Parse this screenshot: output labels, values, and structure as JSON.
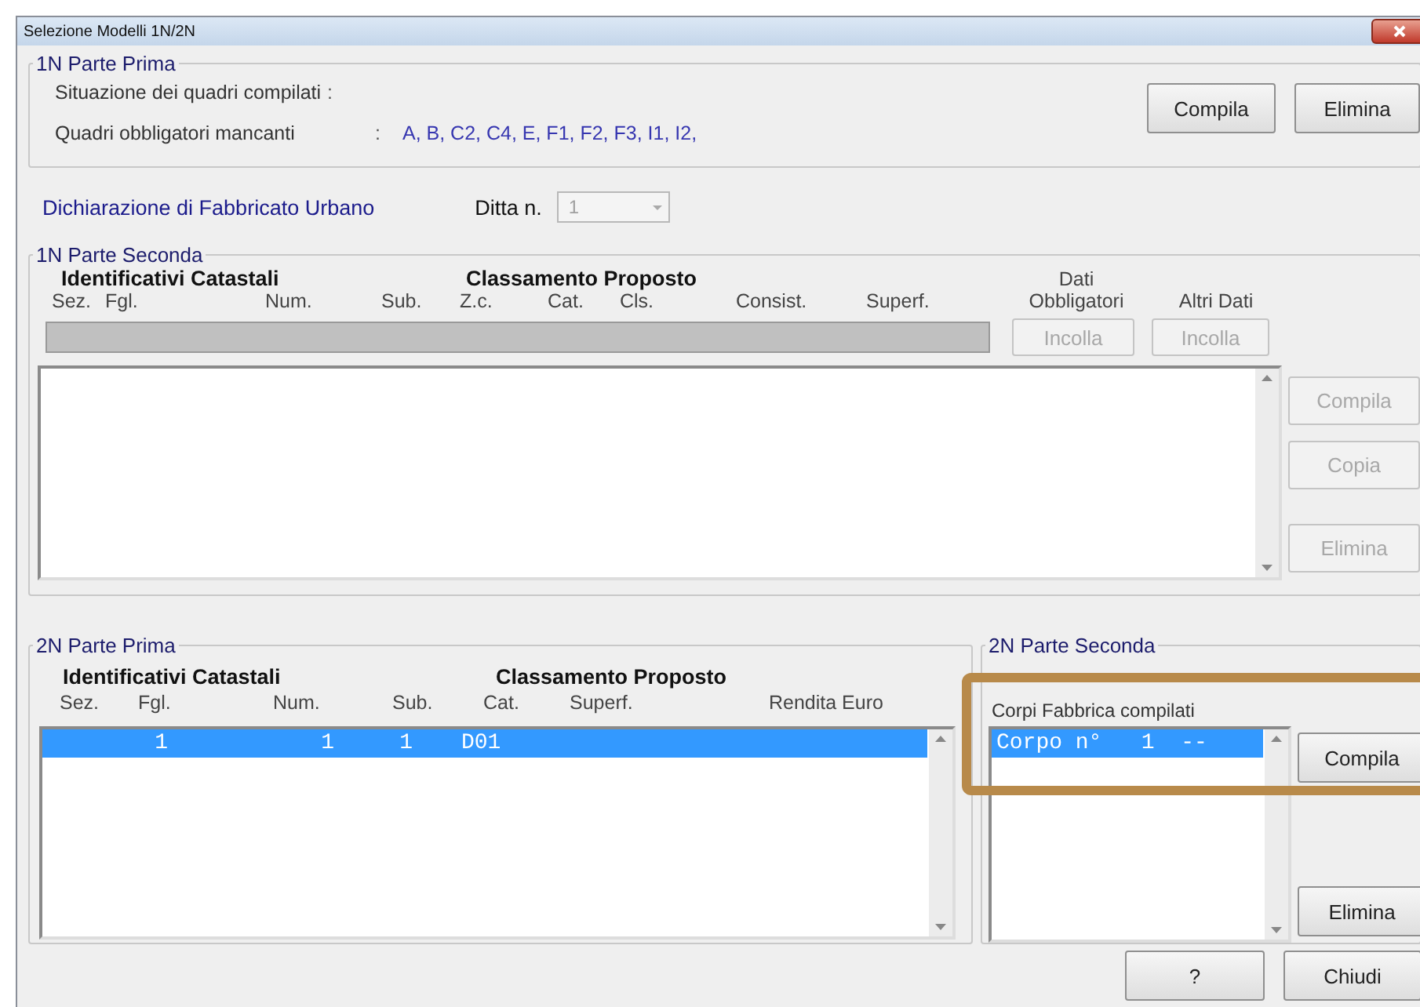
{
  "window": {
    "title": "Selezione Modelli 1N/2N"
  },
  "parte_prima_1n": {
    "legend": "1N Parte Prima",
    "rows": [
      {
        "label": "Situazione dei quadri compilati",
        "separator": ":"
      },
      {
        "label": "Quadri obbligatori mancanti",
        "separator": ":",
        "value": "A, B, C2, C4, E, F1, F2, F3, I1, I2,"
      }
    ],
    "buttons": [
      {
        "label": "Compila",
        "disabled": false
      },
      {
        "label": "Elimina",
        "disabled": false
      }
    ]
  },
  "dichiarazione": {
    "title": "Dichiarazione di Fabbricato Urbano",
    "ditta_label": "Ditta n.",
    "ditta_value": "1",
    "ditta_disabled": true
  },
  "parte_seconda_1n": {
    "legend": "1N Parte Seconda",
    "group_headers": [
      "Identificativi Catastali",
      "Classamento Proposto"
    ],
    "columns": [
      "Sez.",
      "Fgl.",
      "Num.",
      "Sub.",
      "Z.c.",
      "Cat.",
      "Cls.",
      "Consist.",
      "Superf."
    ],
    "data_headers": [
      {
        "lines": [
          "Dati",
          "Obbligatori"
        ]
      },
      {
        "lines": [
          "Altri Dati"
        ]
      }
    ],
    "paste_buttons": [
      {
        "label": "Incolla",
        "disabled": true
      },
      {
        "label": "Incolla",
        "disabled": true
      }
    ],
    "side_buttons": [
      {
        "label": "Compila",
        "disabled": true
      },
      {
        "label": "Copia",
        "disabled": true
      },
      {
        "label": "Elimina",
        "disabled": true
      }
    ]
  },
  "parte_prima_2n": {
    "legend": "2N Parte Prima",
    "group_headers": [
      "Identificativi Catastali",
      "Classamento Proposto"
    ],
    "columns": [
      "Sez.",
      "Fgl.",
      "Num.",
      "Sub.",
      "Cat.",
      "Superf.",
      "Rendita Euro"
    ],
    "rows": [
      {
        "fgl": "1",
        "num": "1",
        "sub": "1",
        "cat": "D01",
        "selected": true
      }
    ]
  },
  "parte_seconda_2n": {
    "legend": "2N Parte Seconda",
    "list_label": "Corpi Fabbrica compilati",
    "items": [
      {
        "text": "Corpo n°   1  --",
        "selected": true
      }
    ],
    "buttons": [
      {
        "label": "Compila",
        "disabled": false
      },
      {
        "label": "Elimina",
        "disabled": false
      }
    ]
  },
  "footer_buttons": [
    {
      "label": "?",
      "disabled": false
    },
    {
      "label": "Chiudi",
      "disabled": false
    }
  ]
}
